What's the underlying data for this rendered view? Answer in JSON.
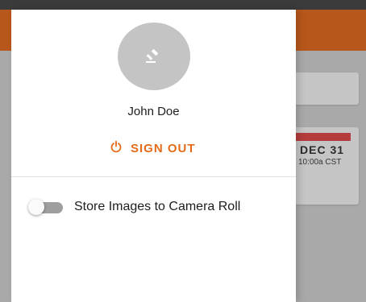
{
  "drawer": {
    "user_name": "John Doe",
    "sign_out_label": "SIGN OUT",
    "setting": {
      "label": "Store Images to Camera Roll",
      "enabled": false
    }
  },
  "background": {
    "date_label": "DEC 31",
    "time_label": "10:00a CST"
  },
  "colors": {
    "accent": "#e36b1a",
    "appbar": "#b8571b"
  }
}
